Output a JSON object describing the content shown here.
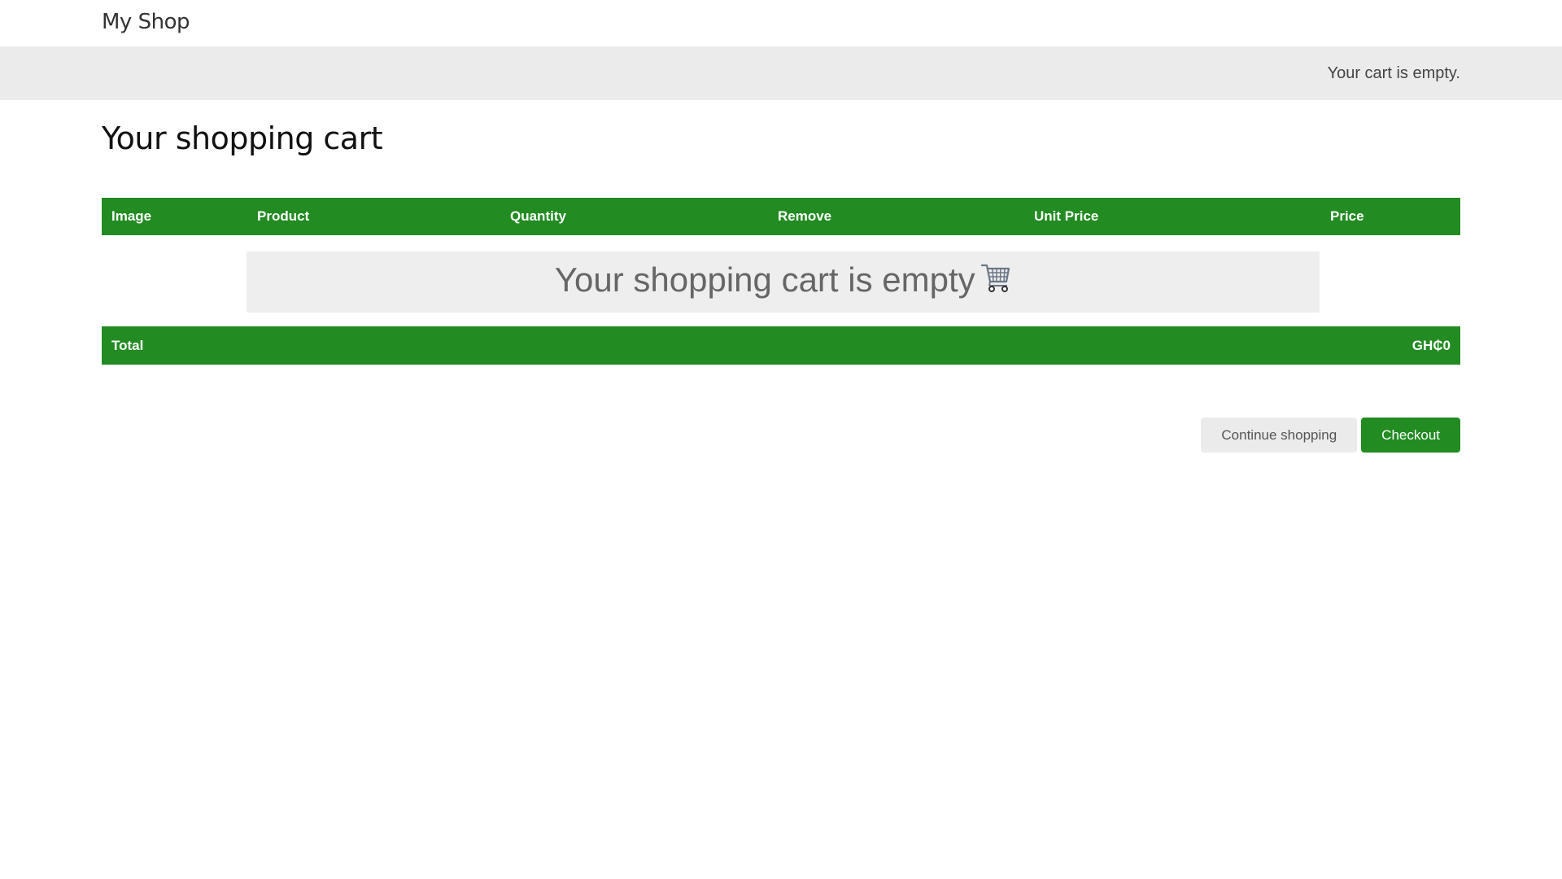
{
  "header": {
    "logo": "My Shop"
  },
  "subheader": {
    "cart_status": "Your cart is empty."
  },
  "page": {
    "title": "Your shopping cart"
  },
  "table": {
    "columns": [
      "Image",
      "Product",
      "Quantity",
      "Remove",
      "Unit Price",
      "Price"
    ],
    "empty_message": "Your shopping cart is empty",
    "empty_icon": "shopping-cart-icon",
    "total_label": "Total",
    "total_value": "GH₵0"
  },
  "actions": {
    "continue_label": "Continue shopping",
    "checkout_label": "Checkout"
  },
  "colors": {
    "accent": "#228b22",
    "subheader_bg": "#ebebeb",
    "empty_box_bg": "#eeeeee"
  }
}
